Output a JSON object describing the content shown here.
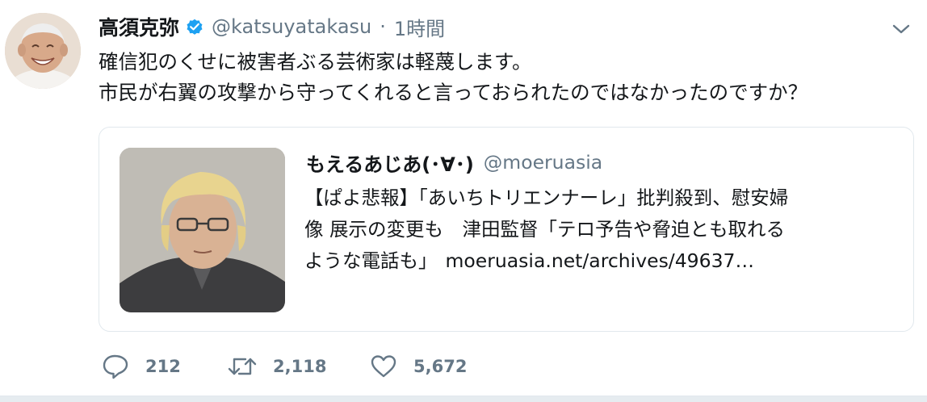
{
  "tweet": {
    "author": {
      "display_name": "高須克弥",
      "handle": "@katsuyatakasu",
      "verified": true
    },
    "separator": "·",
    "time": "1時間",
    "text_lines": [
      "確信犯のくせに被害者ぶる芸術家は軽蔑します。",
      "市民が右翼の攻撃から守ってくれると言っておられたのではなかったのですか？"
    ],
    "quoted": {
      "display_name": "もえるあじあ(･∀･)",
      "handle": "@moeruasia",
      "text_lines": [
        "【ぱよ悲報】「あいちトリエンナーレ」批判殺到、慰安婦",
        "像 展示の変更も　津田監督「テロ予告や脅迫とも取れる",
        "ような電話も」"
      ],
      "link": "moeruasia.net/archives/49637…"
    },
    "actions": {
      "replies": "212",
      "retweets": "2,118",
      "likes": "5,672"
    }
  },
  "icons": {
    "verified": "verified-badge-icon",
    "menu": "chevron-down-icon",
    "reply": "reply-icon",
    "retweet": "retweet-icon",
    "like": "heart-icon"
  },
  "colors": {
    "text": "#14171a",
    "secondary_text": "#657786",
    "verified_blue": "#1da1f2",
    "border": "#e1e8ed"
  }
}
